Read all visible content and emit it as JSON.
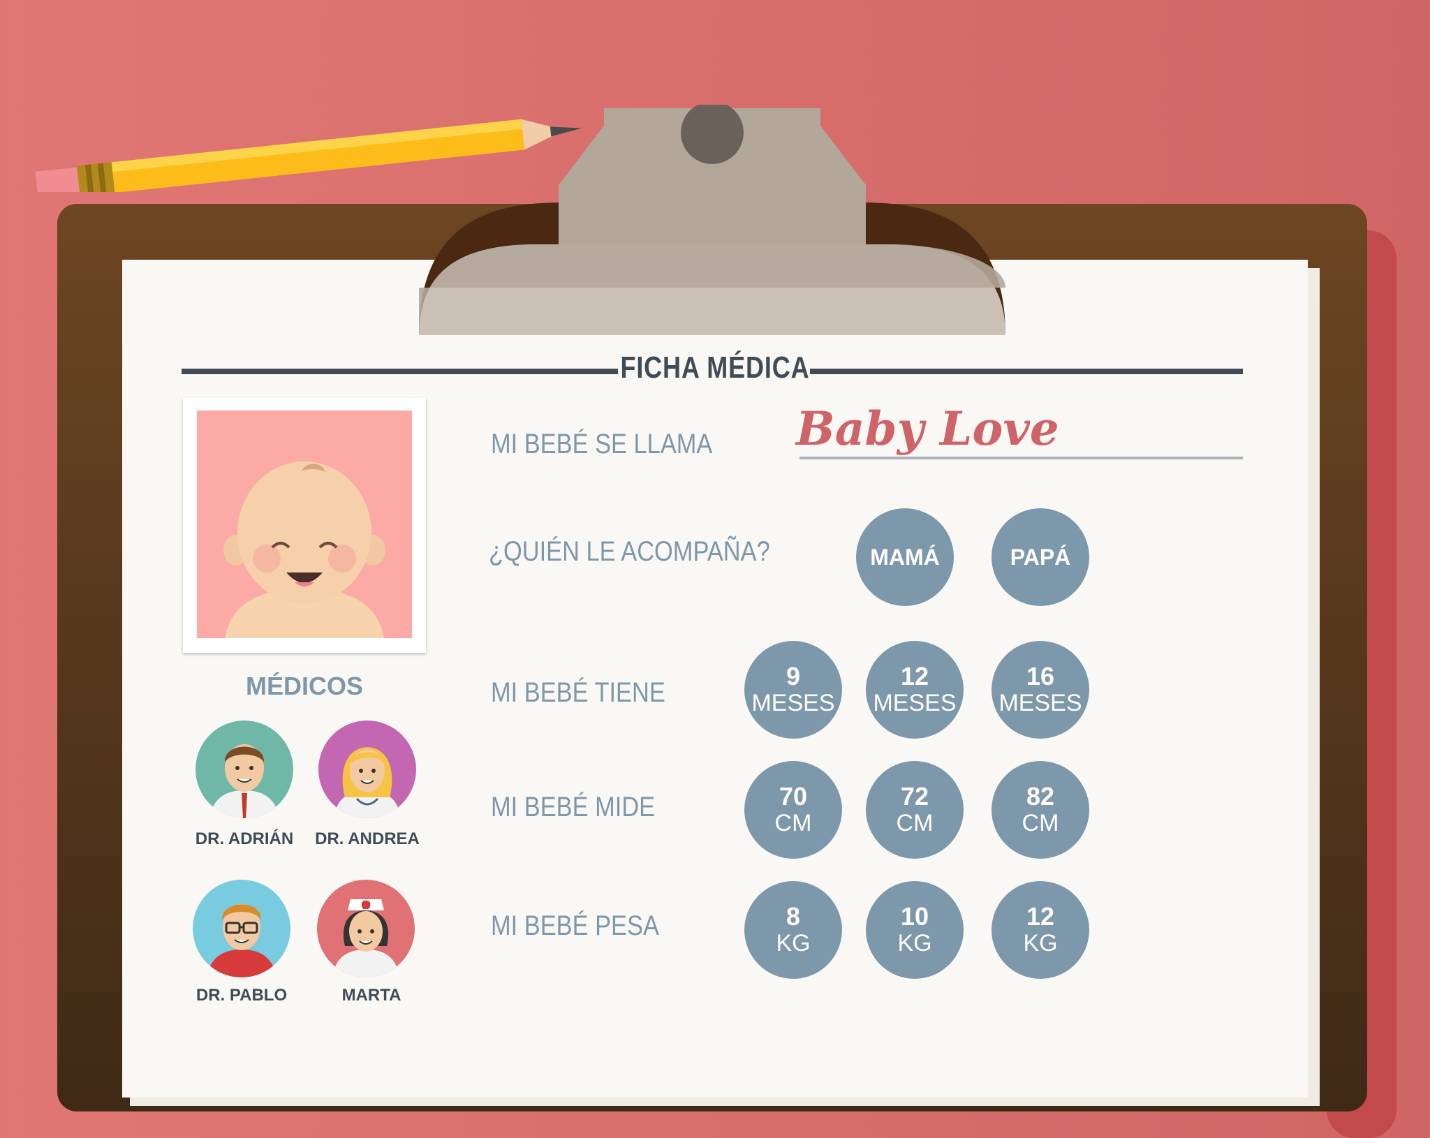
{
  "title": "FICHA MÉDICA",
  "baby_name": "Baby Love",
  "medicos_heading": "MÉDICOS",
  "doctors": [
    {
      "name": "DR. ADRIÁN",
      "avatar_icon": "male-doctor-icon",
      "bg": "#6fb8a8"
    },
    {
      "name": "DR. ANDREA",
      "avatar_icon": "female-doctor-icon",
      "bg": "#c467b2"
    },
    {
      "name": "DR. PABLO",
      "avatar_icon": "glasses-doctor-icon",
      "bg": "#79cbe0"
    },
    {
      "name": "MARTA",
      "avatar_icon": "nurse-icon",
      "bg": "#e07174"
    }
  ],
  "questions": {
    "name": "MI BEBÉ SE LLAMA",
    "companion": "¿QUIÉN LE ACOMPAÑA?",
    "age": "MI BEBÉ TIENE",
    "height": "MI BEBÉ MIDE",
    "weight": "MI BEBÉ PESA"
  },
  "companion_options": [
    "MAMÁ",
    "PAPÁ"
  ],
  "age_options": [
    {
      "value": "9",
      "unit": "MESES"
    },
    {
      "value": "12",
      "unit": "MESES"
    },
    {
      "value": "16",
      "unit": "MESES"
    }
  ],
  "height_options": [
    {
      "value": "70",
      "unit": "CM"
    },
    {
      "value": "72",
      "unit": "CM"
    },
    {
      "value": "82",
      "unit": "CM"
    }
  ],
  "weight_options": [
    {
      "value": "8",
      "unit": "KG"
    },
    {
      "value": "10",
      "unit": "KG"
    },
    {
      "value": "12",
      "unit": "KG"
    }
  ],
  "colors": {
    "background": "#dd7472",
    "board": "#5a3a1e",
    "paper": "#faf8f4",
    "option_circle": "#7d97ab",
    "title": "#3f4c55",
    "baby_name": "#cf6468"
  }
}
